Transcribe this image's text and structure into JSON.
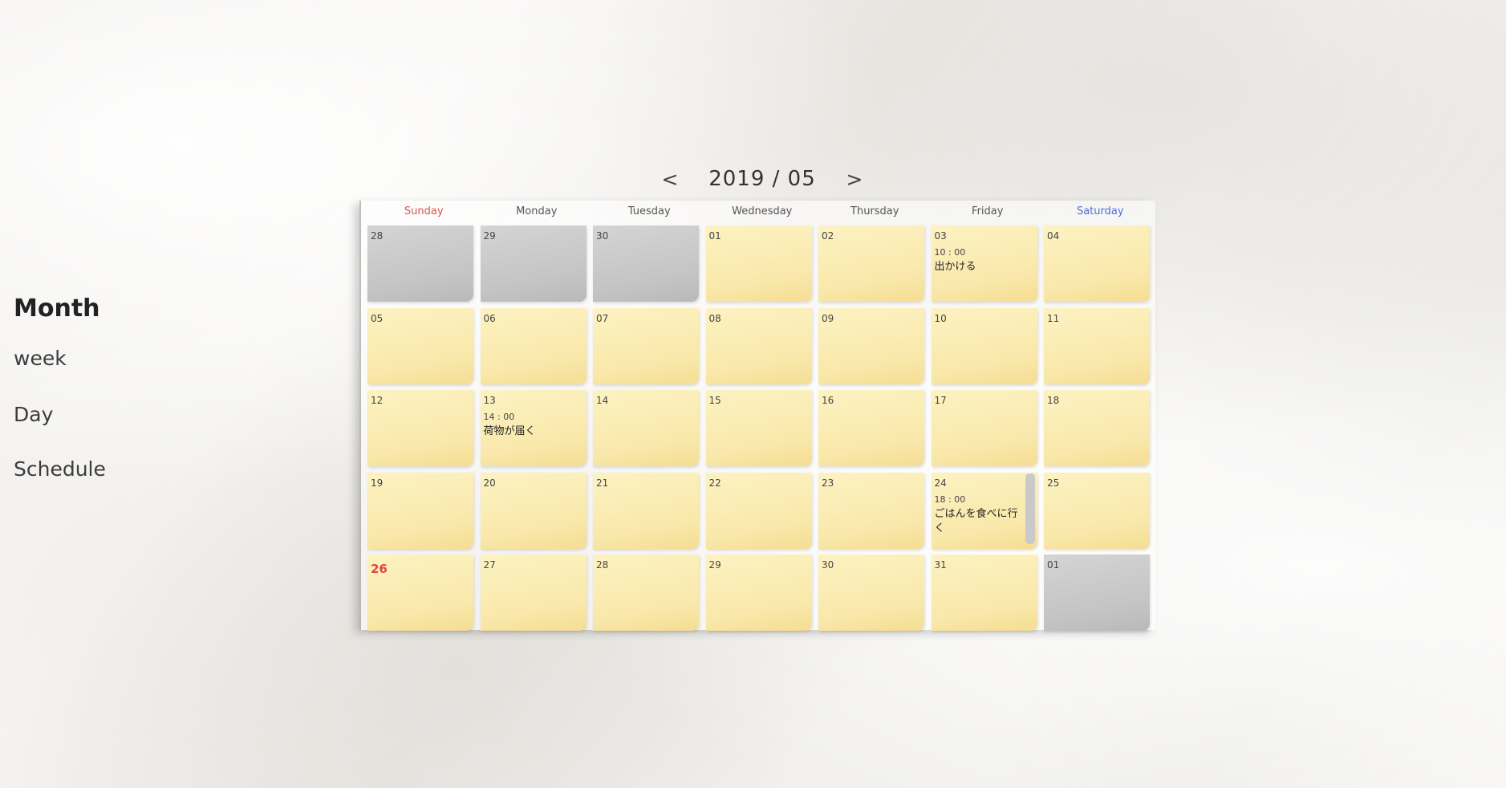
{
  "nav": {
    "month": "Month",
    "week": "week",
    "day": "Day",
    "schedule": "Schedule"
  },
  "header": {
    "prev": "<",
    "title": "2019 / 05",
    "next": ">"
  },
  "weekdays": [
    "Sunday",
    "Monday",
    "Tuesday",
    "Wednesday",
    "Thursday",
    "Friday",
    "Saturday"
  ],
  "weeks": [
    [
      {
        "date": "28",
        "other": true
      },
      {
        "date": "29",
        "other": true
      },
      {
        "date": "30",
        "other": true
      },
      {
        "date": "01"
      },
      {
        "date": "02"
      },
      {
        "date": "03",
        "event": {
          "time": "10 : 00",
          "title": "出かける"
        }
      },
      {
        "date": "04"
      }
    ],
    [
      {
        "date": "05"
      },
      {
        "date": "06"
      },
      {
        "date": "07"
      },
      {
        "date": "08"
      },
      {
        "date": "09"
      },
      {
        "date": "10"
      },
      {
        "date": "11"
      }
    ],
    [
      {
        "date": "12"
      },
      {
        "date": "13",
        "event": {
          "time": "14 : 00",
          "title": "荷物が届く"
        }
      },
      {
        "date": "14"
      },
      {
        "date": "15"
      },
      {
        "date": "16"
      },
      {
        "date": "17"
      },
      {
        "date": "18"
      }
    ],
    [
      {
        "date": "19"
      },
      {
        "date": "20"
      },
      {
        "date": "21"
      },
      {
        "date": "22"
      },
      {
        "date": "23"
      },
      {
        "date": "24",
        "event": {
          "time": "18 : 00",
          "title": "ごはんを食べに行く"
        },
        "scroll": true
      },
      {
        "date": "25"
      }
    ],
    [
      {
        "date": "26",
        "today": true
      },
      {
        "date": "27"
      },
      {
        "date": "28"
      },
      {
        "date": "29"
      },
      {
        "date": "30"
      },
      {
        "date": "31"
      },
      {
        "date": "01",
        "other": true
      }
    ]
  ]
}
